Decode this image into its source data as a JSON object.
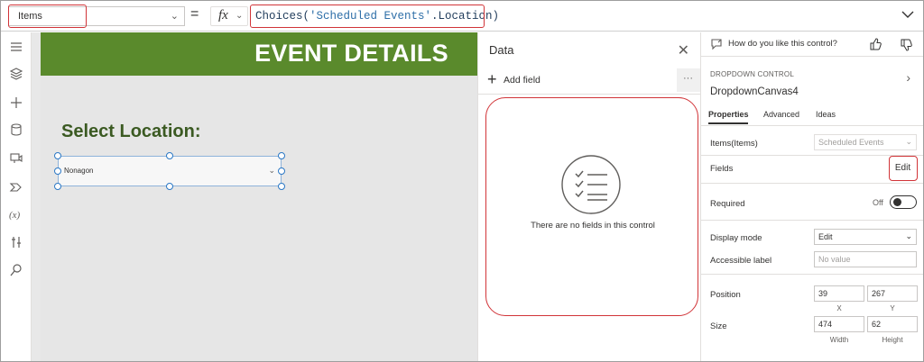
{
  "formula_bar": {
    "property": "Items",
    "equals": "=",
    "fx": "fx",
    "formula_fn": "Choices(",
    "formula_arg": "'Scheduled Events'",
    "formula_rest": ".Location)"
  },
  "left_rail": {
    "icons": [
      "hamburger-icon",
      "layers-icon",
      "add-icon",
      "database-icon",
      "media-icon",
      "power-automate-icon",
      "variables-icon",
      "tools-icon",
      "search-icon"
    ]
  },
  "canvas": {
    "banner_title": "EVENT DETAILS",
    "select_label": "Select Location:",
    "dropdown_value": "Nonagon"
  },
  "data_panel": {
    "title": "Data",
    "add_field_label": "Add field",
    "more_label": "···",
    "empty_message": "There are no fields in this control"
  },
  "properties": {
    "feedback_prompt": "How do you like this control?",
    "control_type": "DROPDOWN CONTROL",
    "control_name": "DropdownCanvas4",
    "tabs": [
      "Properties",
      "Advanced",
      "Ideas"
    ],
    "items_label": "Items(Items)",
    "items_value": "Scheduled Events",
    "fields_label": "Fields",
    "edit_label": "Edit",
    "required_label": "Required",
    "required_value": "Off",
    "display_mode_label": "Display mode",
    "display_mode_value": "Edit",
    "accessible_label": "Accessible label",
    "accessible_placeholder": "No value",
    "position_label": "Position",
    "position_x": "39",
    "position_y": "267",
    "x_caption": "X",
    "y_caption": "Y",
    "size_label": "Size",
    "width": "474",
    "height": "62",
    "width_caption": "Width",
    "height_caption": "Height"
  },
  "colors": {
    "banner": "#5a8a2c",
    "highlight": "#d13438",
    "selection": "#2b78c5"
  }
}
